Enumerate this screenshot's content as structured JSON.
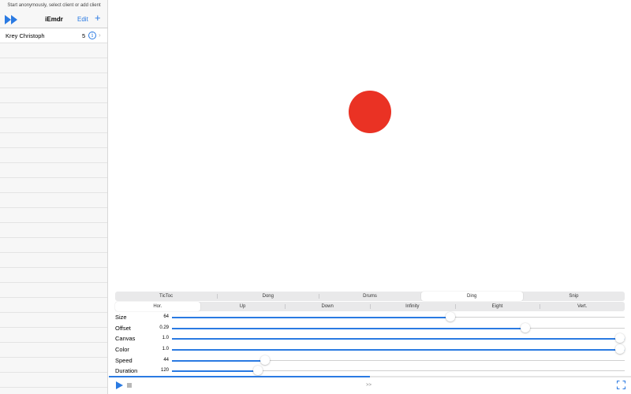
{
  "sidebar": {
    "hint": "Start anonymously, select client or add client",
    "title": "iEmdr",
    "edit_label": "Edit",
    "add_label": "+",
    "clients": [
      {
        "name": "Krey Christoph",
        "count": "5"
      }
    ]
  },
  "stimulus": {
    "color": "#ea3224"
  },
  "sound_tabs": {
    "items": [
      "TicToc",
      "Dong",
      "Drums",
      "Ding",
      "Snip"
    ],
    "selected": "Ding"
  },
  "motion_tabs": {
    "items": [
      "Hor.",
      "Up",
      "Down",
      "Infinity",
      "Eight",
      "Vert."
    ],
    "selected": "Hor."
  },
  "sliders": [
    {
      "label": "Size",
      "value": "64",
      "fraction": 0.615
    },
    {
      "label": "Offset",
      "value": "0.29",
      "fraction": 0.78
    },
    {
      "label": "Canvas",
      "value": "1.0",
      "fraction": 1.0
    },
    {
      "label": "Color",
      "value": "1.0",
      "fraction": 1.0
    },
    {
      "label": "Speed",
      "value": "44",
      "fraction": 0.205
    },
    {
      "label": "Duration",
      "value": "120",
      "fraction": 0.19
    }
  ],
  "playback": {
    "progress": 0.5,
    "ff_label": ">>"
  },
  "colors": {
    "accent": "#2a7ae2"
  }
}
